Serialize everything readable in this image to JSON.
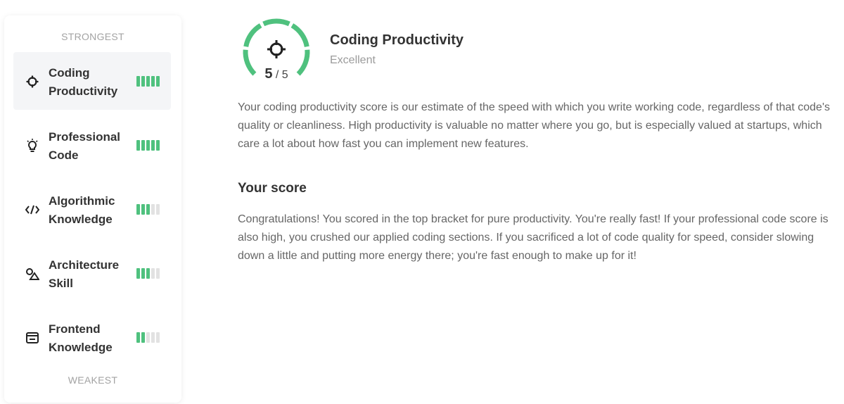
{
  "sidebar": {
    "top_caption": "STRONGEST",
    "bottom_caption": "WEAKEST",
    "items": [
      {
        "label": "Coding Productivity",
        "icon": "crosshair-icon",
        "level": 5,
        "max": 5,
        "active": true
      },
      {
        "label": "Professional Code",
        "icon": "lightbulb-icon",
        "level": 5,
        "max": 5,
        "active": false
      },
      {
        "label": "Algorithmic Knowledge",
        "icon": "code-icon",
        "level": 3,
        "max": 5,
        "active": false
      },
      {
        "label": "Architecture Skill",
        "icon": "shapes-icon",
        "level": 3,
        "max": 5,
        "active": false
      },
      {
        "label": "Frontend Knowledge",
        "icon": "browser-window-icon",
        "level": 2,
        "max": 5,
        "active": false
      }
    ]
  },
  "detail": {
    "title": "Coding Productivity",
    "rating": "Excellent",
    "score": "5",
    "score_max": "/ 5",
    "gauge_fraction": 1.0,
    "gauge_icon": "crosshair-icon",
    "description": "Your coding productivity score is our estimate of the speed with which you write working code, regardless of that code's quality or cleanliness. High productivity is valuable no matter where you go, but is especially valued at startups, which care a lot about how fast you can implement new features.",
    "score_heading": "Your score",
    "score_text": "Congratulations! You scored in the top bracket for pure productivity. You're really fast! If your professional code score is also high, you crushed our applied coding sections. If you sacrificed a lot of code quality for speed, consider slowing down a little and putting more energy there; you're fast enough to make up for it!"
  },
  "colors": {
    "accent": "#4fc17e",
    "bar_off": "#e2e2e2",
    "active_bg": "#f4f5f7"
  }
}
